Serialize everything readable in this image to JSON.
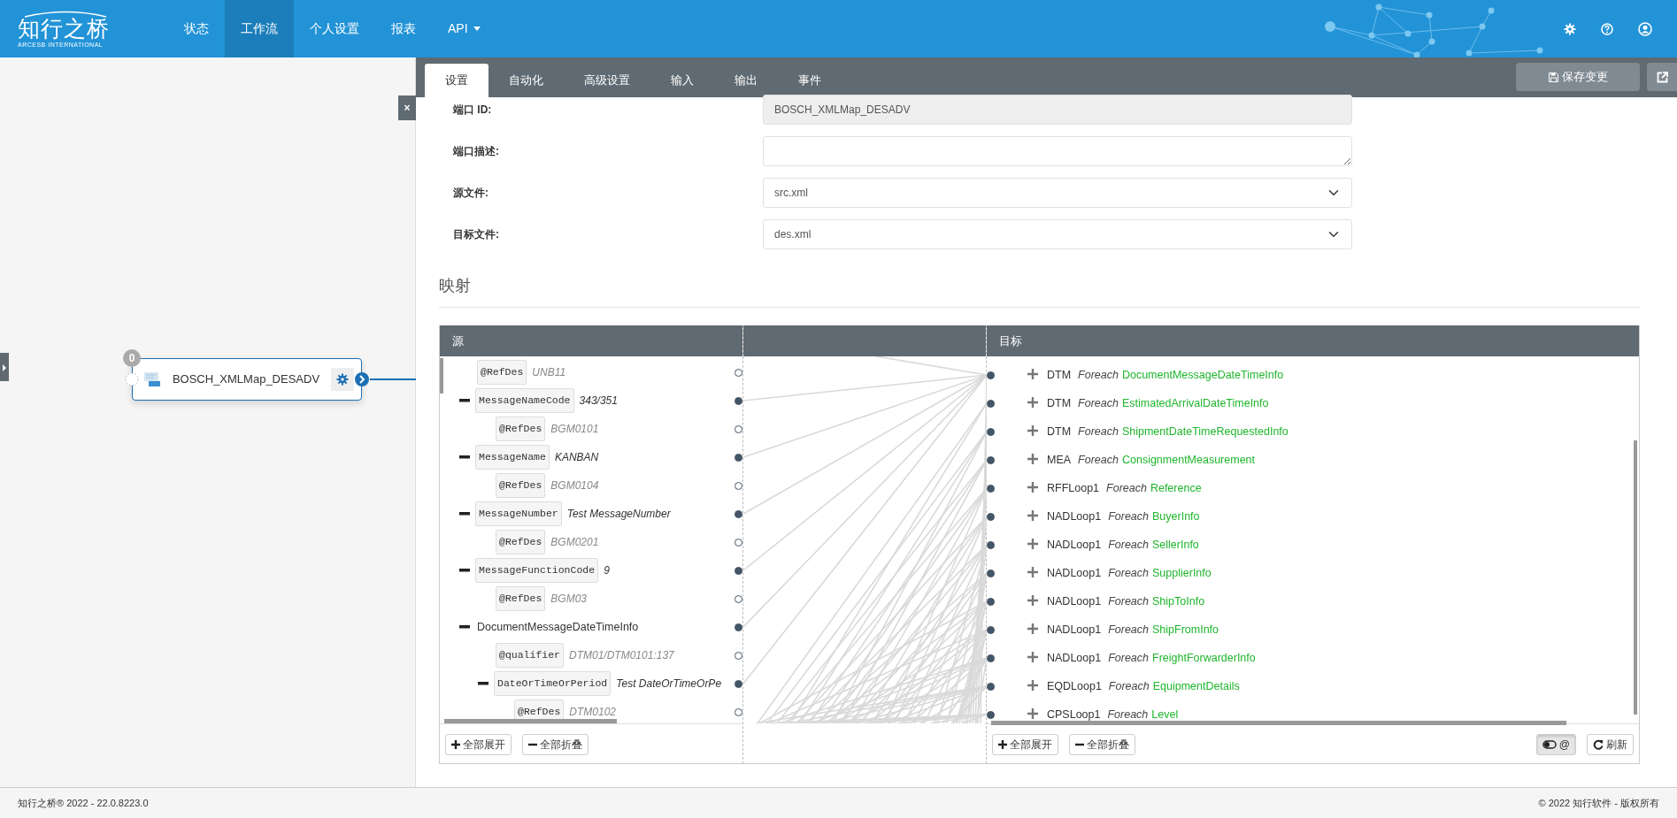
{
  "brand": {
    "name": "知行之桥",
    "tagline": "ARCESB INTERNATIONAL"
  },
  "nav": [
    {
      "label": "状态",
      "selected": false,
      "dropdown": false
    },
    {
      "label": "工作流",
      "selected": true,
      "dropdown": false
    },
    {
      "label": "个人设置",
      "selected": false,
      "dropdown": false
    },
    {
      "label": "报表",
      "selected": false,
      "dropdown": false
    },
    {
      "label": "API",
      "selected": false,
      "dropdown": true
    }
  ],
  "canvas": {
    "node": {
      "title": "BOSCH_XMLMap_DESADV",
      "badge": "0"
    },
    "close_button": "×"
  },
  "tabs": [
    {
      "label": "设置",
      "selected": true
    },
    {
      "label": "自动化",
      "selected": false
    },
    {
      "label": "高级设置",
      "selected": false
    },
    {
      "label": "输入",
      "selected": false
    },
    {
      "label": "输出",
      "selected": false
    },
    {
      "label": "事件",
      "selected": false
    }
  ],
  "save_button": "保存变更",
  "form": [
    {
      "label": "端口 ID:",
      "kind": "readonly",
      "value": "BOSCH_XMLMap_DESADV"
    },
    {
      "label": "端口描述:",
      "kind": "textarea"
    },
    {
      "label": "源文件:",
      "kind": "select",
      "value": "src.xml"
    },
    {
      "label": "目标文件:",
      "kind": "select",
      "value": "des.xml"
    }
  ],
  "mapping": {
    "heading": "映射",
    "source_header": "源",
    "target_header": "目标",
    "source_tree": {
      "attributes": [
        {
          "name": "@RefDes",
          "value": "UNB11",
          "mapped": false
        }
      ],
      "elements": [
        {
          "kind": "field",
          "name": "MessageNameCode",
          "value": "343/351",
          "mapped": true,
          "attributes": [
            {
              "name": "@RefDes",
              "value": "BGM0101",
              "mapped": false
            }
          ]
        },
        {
          "kind": "field",
          "name": "MessageName",
          "value": "KANBAN",
          "mapped": true,
          "attributes": [
            {
              "name": "@RefDes",
              "value": "BGM0104",
              "mapped": false
            }
          ]
        },
        {
          "kind": "field",
          "name": "MessageNumber",
          "value": "Test MessageNumber",
          "mapped": true,
          "attributes": [
            {
              "name": "@RefDes",
              "value": "BGM0201",
              "mapped": false
            }
          ]
        },
        {
          "kind": "field",
          "name": "MessageFunctionCode",
          "value": "9",
          "mapped": true,
          "attributes": [
            {
              "name": "@RefDes",
              "value": "BGM03",
              "mapped": false
            }
          ]
        },
        {
          "kind": "group",
          "name": "DocumentMessageDateTimeInfo",
          "mapped": true,
          "attributes": [
            {
              "name": "@qualifier",
              "value": "DTM01/DTM0101:137",
              "mapped": false
            }
          ],
          "children": [
            {
              "kind": "field",
              "name": "DateOrTimeOrPeriod",
              "value": "Test DateOrTimeOrPe",
              "mapped": true,
              "attributes": [
                {
                  "name": "@RefDes",
                  "value": "DTM0102",
                  "mapped": false
                }
              ]
            }
          ]
        }
      ]
    },
    "target_rows": [
      {
        "name": "DTM",
        "loop": "Foreach",
        "source": "DocumentMessageDateTimeInfo",
        "mapped": true
      },
      {
        "name": "DTM",
        "loop": "Foreach",
        "source": "EstimatedArrivalDateTimeInfo",
        "mapped": true
      },
      {
        "name": "DTM",
        "loop": "Foreach",
        "source": "ShipmentDateTimeRequestedInfo",
        "mapped": true
      },
      {
        "name": "MEA",
        "loop": "Foreach",
        "source": "ConsignmentMeasurement",
        "mapped": true
      },
      {
        "name": "RFFLoop1",
        "loop": "Foreach",
        "source": "Reference",
        "mapped": true
      },
      {
        "name": "NADLoop1",
        "loop": "Foreach",
        "source": "BuyerInfo",
        "mapped": true
      },
      {
        "name": "NADLoop1",
        "loop": "Foreach",
        "source": "SellerInfo",
        "mapped": true
      },
      {
        "name": "NADLoop1",
        "loop": "Foreach",
        "source": "SupplierInfo",
        "mapped": true
      },
      {
        "name": "NADLoop1",
        "loop": "Foreach",
        "source": "ShipToInfo",
        "mapped": true
      },
      {
        "name": "NADLoop1",
        "loop": "Foreach",
        "source": "ShipFromInfo",
        "mapped": true
      },
      {
        "name": "NADLoop1",
        "loop": "Foreach",
        "source": "FreightForwarderInfo",
        "mapped": true
      },
      {
        "name": "EQDLoop1",
        "loop": "Foreach",
        "source": "EquipmentDetails",
        "mapped": true
      },
      {
        "name": "CPSLoop1",
        "loop": "Foreach",
        "source": "Level",
        "mapped": true
      }
    ],
    "source_buttons": [
      {
        "label": "全部展开",
        "kind": "expand"
      },
      {
        "label": "全部折叠",
        "kind": "collapse"
      }
    ],
    "target_buttons": [
      {
        "label": "全部展开",
        "kind": "expand"
      },
      {
        "label": "全部折叠",
        "kind": "collapse"
      }
    ],
    "toggle": {
      "label": "@",
      "pressed": true
    },
    "refresh_button": "刷新"
  },
  "footer": {
    "left": "知行之桥® 2022 - 22.0.8223.0",
    "right": "© 2022 知行软件 - 版权所有"
  }
}
